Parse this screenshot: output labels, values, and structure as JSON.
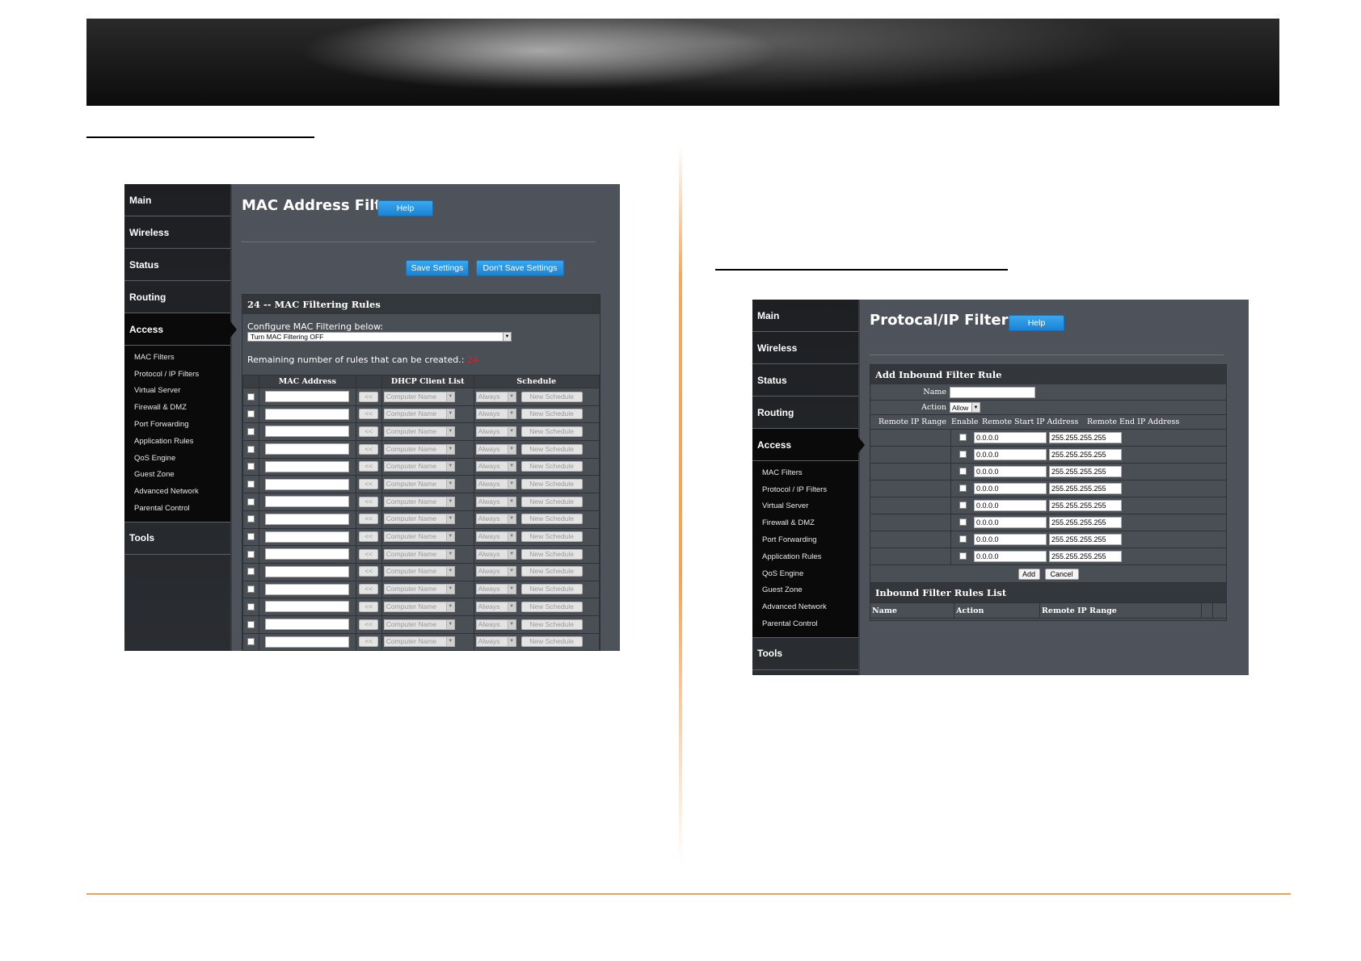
{
  "mac_screen": {
    "sidebar": {
      "main": "Main",
      "wireless": "Wireless",
      "status": "Status",
      "routing": "Routing",
      "access": "Access",
      "sub_items": [
        "MAC Filters",
        "Protocol / IP Filters",
        "Virtual Server",
        "Firewall & DMZ",
        "Port Forwarding",
        "Application Rules",
        "QoS Engine",
        "Guest Zone",
        "Advanced Network",
        "Parental Control"
      ],
      "tools": "Tools"
    },
    "title": "MAC Address Filter",
    "help_label": "Help",
    "save_label": "Save Settings",
    "dont_save_label": "Don't Save Settings",
    "panel_title": "24 -- MAC Filtering Rules",
    "configure_label": "Configure MAC Filtering below:",
    "filter_select_value": "Turn MAC Filtering OFF",
    "remaining_label": "Remaining number of rules that can be created.:",
    "remaining_value": "24",
    "columns": [
      "MAC Address",
      "DHCP Client List",
      "Schedule"
    ],
    "row_copy_label": "<<",
    "row_client_placeholder": "Computer Name",
    "row_schedule_value": "Always",
    "row_new_schedule_label": "New Schedule",
    "row_count": 15
  },
  "ip_screen": {
    "sidebar": {
      "main": "Main",
      "wireless": "Wireless",
      "status": "Status",
      "routing": "Routing",
      "access": "Access",
      "sub_items": [
        "MAC Filters",
        "Protocol / IP Filters",
        "Virtual Server",
        "Firewall & DMZ",
        "Port Forwarding",
        "Application Rules",
        "QoS Engine",
        "Guest Zone",
        "Advanced Network",
        "Parental Control"
      ],
      "tools": "Tools"
    },
    "title": "Protocal/IP Filters",
    "help_label": "Help",
    "add_panel_title": "Add Inbound Filter Rule",
    "name_label": "Name",
    "action_label": "Action",
    "action_value": "Allow",
    "range_label": "Remote IP Range",
    "enable_label": "Enable",
    "start_label": "Remote Start IP Address",
    "end_label": "Remote End IP Address",
    "start_value": "0.0.0.0",
    "end_value": "255.255.255.255",
    "range_rows": 8,
    "add_label": "Add",
    "cancel_label": "Cancel",
    "list_title": "Inbound Filter Rules List",
    "list_columns": [
      "Name",
      "Action",
      "Remote IP Range"
    ]
  }
}
